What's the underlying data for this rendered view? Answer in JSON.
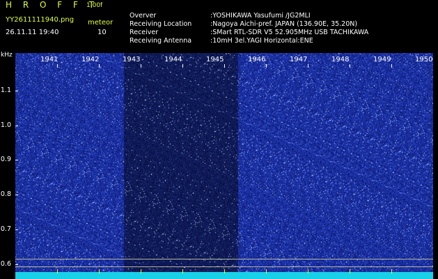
{
  "header": {
    "app_title": "H R O F F T",
    "version": "1.00f",
    "filename": "YY2611111940.png",
    "mode": "meteor",
    "datetime": "26.11.11 19:40",
    "count": "10"
  },
  "info": [
    {
      "key": "Overver",
      "value": ":YOSHIKAWA Yasufumi /JG2MLI"
    },
    {
      "key": "Receiving Location",
      "value": ":Nagoya Aichi-pref. JAPAN (136.90E, 35.20N)"
    },
    {
      "key": "Receiver",
      "value": ":SMart RTL-SDR V5 52.905MHz USB TACHIKAWA"
    },
    {
      "key": "Receiving Antenna",
      "value": ":10mH 3el.YAGI Horizontal:ENE"
    }
  ],
  "axis": {
    "y_unit": "kHz",
    "y_ticks": [
      "1.1",
      "1.0",
      "0.9",
      "0.8",
      "0.7",
      "0.6"
    ],
    "x_ticks": [
      "1941",
      "1942",
      "1943",
      "1944",
      "1945",
      "1946",
      "1947",
      "1948",
      "1949",
      "1950"
    ]
  },
  "colors": {
    "background": "#000000",
    "spectrum_bg": "#1a2ea0",
    "header_accent": "#dfff3a",
    "baseline": "#18d0e8"
  }
}
